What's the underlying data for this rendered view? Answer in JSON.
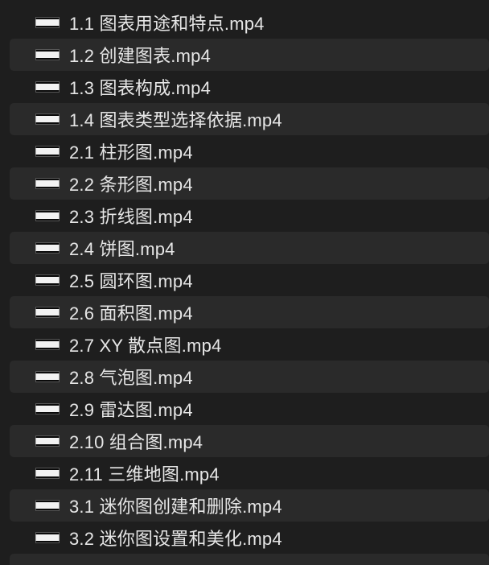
{
  "files": [
    {
      "name": "1.1 图表用途和特点.mp4",
      "icon": "video-file-icon"
    },
    {
      "name": "1.2 创建图表.mp4",
      "icon": "video-file-icon"
    },
    {
      "name": "1.3 图表构成.mp4",
      "icon": "video-file-icon"
    },
    {
      "name": "1.4 图表类型选择依据.mp4",
      "icon": "video-file-icon"
    },
    {
      "name": "2.1 柱形图.mp4",
      "icon": "video-file-icon"
    },
    {
      "name": "2.2 条形图.mp4",
      "icon": "video-file-icon"
    },
    {
      "name": "2.3 折线图.mp4",
      "icon": "video-file-icon"
    },
    {
      "name": "2.4 饼图.mp4",
      "icon": "video-file-icon"
    },
    {
      "name": "2.5 圆环图.mp4",
      "icon": "video-file-icon"
    },
    {
      "name": "2.6 面积图.mp4",
      "icon": "video-file-icon"
    },
    {
      "name": "2.7 XY 散点图.mp4",
      "icon": "video-file-icon"
    },
    {
      "name": "2.8 气泡图.mp4",
      "icon": "video-file-icon"
    },
    {
      "name": "2.9 雷达图.mp4",
      "icon": "video-file-icon"
    },
    {
      "name": "2.10 组合图.mp4",
      "icon": "video-file-icon"
    },
    {
      "name": "2.11 三维地图.mp4",
      "icon": "video-file-icon"
    },
    {
      "name": "3.1 迷你图创建和删除.mp4",
      "icon": "video-file-icon"
    },
    {
      "name": "3.2 迷你图设置和美化.mp4",
      "icon": "video-file-icon"
    }
  ],
  "colors": {
    "background": "#1e1e1e",
    "alternate_row": "#2a2a2a",
    "text": "#e6e6e6"
  }
}
